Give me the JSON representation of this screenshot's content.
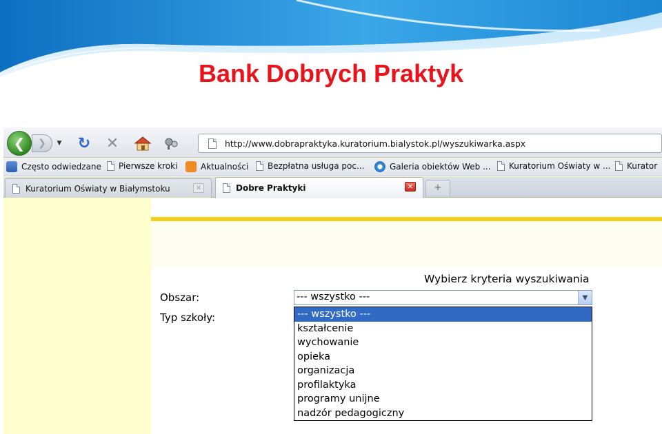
{
  "slide": {
    "title": "Bank Dobrych Praktyk",
    "title_color": "#e8141c",
    "accent_color": "#1f8fd6"
  },
  "browser": {
    "url": "http://www.dobrapraktyka.kuratorium.bialystok.pl/wyszukiwarka.aspx",
    "icons": [
      "back-icon",
      "forward-icon",
      "history-dropdown-icon",
      "reload-icon",
      "stop-icon",
      "home-icon",
      "tools-icon"
    ],
    "bookmarks": [
      {
        "label": "Często odwiedzane",
        "icon": "smart-bookmark-icon"
      },
      {
        "label": "Pierwsze kroki",
        "icon": "page-icon"
      },
      {
        "label": "Aktualności",
        "icon": "rss-icon"
      },
      {
        "label": "Bezpłatna usługa poc...",
        "icon": "page-icon"
      },
      {
        "label": "Galeria obiektów Web ...",
        "icon": "ie-icon"
      },
      {
        "label": "Kuratorium Oświaty w ...",
        "icon": "page-icon"
      },
      {
        "label": "Kurator",
        "icon": "page-icon"
      }
    ],
    "tabs": [
      {
        "label": "Kuratorium Oświaty w Białymstoku",
        "active": false
      },
      {
        "label": "Dobre Praktyki",
        "active": true
      }
    ],
    "new_tab_label": "+"
  },
  "page": {
    "panel_accent": "#f2cf17",
    "background": "#fefdcc",
    "criteria_title": "Wybierz kryteria wyszukiwania",
    "fields": {
      "obszar_label": "Obszar:",
      "typ_szkoly_label": "Typ szkoły:"
    },
    "select": {
      "value": "--- wszystko ---",
      "options": [
        "--- wszystko ---",
        "kształcenie",
        "wychowanie",
        "opieka",
        "organizacja",
        "profilaktyka",
        "programy unijne",
        "nadzór pedagogiczny"
      ],
      "selected_index": 0
    }
  }
}
